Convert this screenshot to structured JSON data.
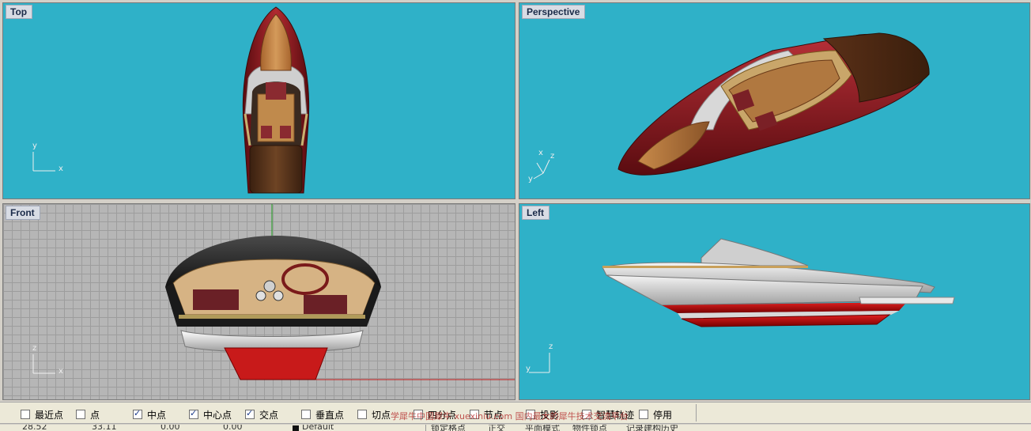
{
  "viewports": {
    "top": {
      "label": "Top",
      "axis_x": "x",
      "axis_y": "y"
    },
    "perspective": {
      "label": "Perspective",
      "axis_x": "x",
      "axis_y": "y",
      "axis_z": "z"
    },
    "front": {
      "label": "Front",
      "axis_x": "x",
      "axis_z": "z"
    },
    "left": {
      "label": "Left",
      "axis_y": "y",
      "axis_z": "z"
    }
  },
  "osnap": {
    "items": [
      {
        "label": "最近点",
        "checked": false
      },
      {
        "label": "点",
        "checked": false
      },
      {
        "label": "中点",
        "checked": true
      },
      {
        "label": "中心点",
        "checked": true
      },
      {
        "label": "交点",
        "checked": true
      },
      {
        "label": "垂直点",
        "checked": false
      },
      {
        "label": "切点",
        "checked": false
      },
      {
        "label": "四分点",
        "checked": false
      },
      {
        "label": "节点",
        "checked": false
      },
      {
        "label": "投影",
        "checked": false
      },
      {
        "label": "智慧轨迹",
        "checked": false
      },
      {
        "label": "停用",
        "checked": false
      }
    ]
  },
  "watermark": {
    "text": "学犀牛中国犀牛 xuexiniu.com 国内最大的犀牛技术交流平台"
  },
  "status": {
    "x": "28.52",
    "y": "33.11",
    "z": "0.00",
    "z2": "0.00",
    "layer": "Default",
    "snap": "锁定格点",
    "ortho": "正交",
    "planar": "平面模式",
    "osnap": "物件锁点",
    "history": "记录建构历史"
  },
  "colors": {
    "viewport_bg": "#2fb1c8",
    "grid_bg": "#b6b6b6",
    "hull_red": "#8a1a1f",
    "wood": "#b5753a",
    "silver": "#c8c8c8"
  }
}
